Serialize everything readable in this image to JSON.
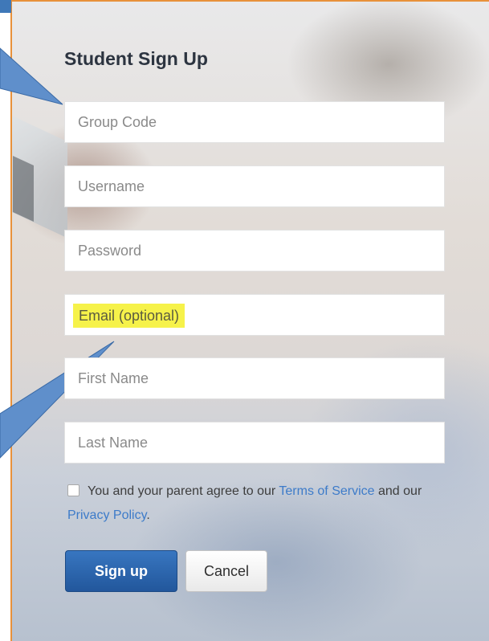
{
  "form": {
    "title": "Student Sign Up",
    "fields": [
      {
        "placeholder": "Group Code"
      },
      {
        "placeholder": "Username"
      },
      {
        "placeholder": "Password"
      },
      {
        "placeholder": "Email (optional)"
      },
      {
        "placeholder": "First Name"
      },
      {
        "placeholder": "Last Name"
      }
    ],
    "terms": {
      "prefix": "You and your parent agree to our",
      "tos_link": "Terms of Service",
      "middle": "and our",
      "privacy_link": "Privacy Policy",
      "suffix": "."
    },
    "buttons": {
      "signup": "Sign up",
      "cancel": "Cancel"
    }
  },
  "colors": {
    "accent_blue": "#2a64ab",
    "link": "#3d7bc9",
    "highlight": "#f6f24a",
    "frame_border": "#e8913a",
    "callout": "#4a7ec0"
  }
}
